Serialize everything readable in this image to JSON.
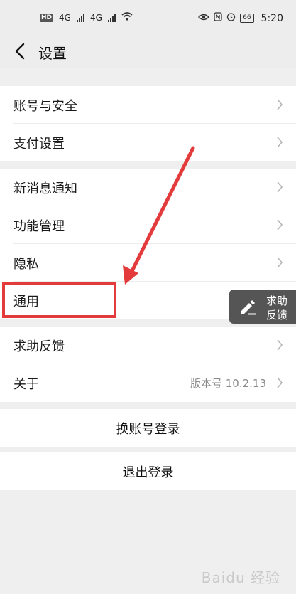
{
  "status_bar": {
    "hd_badge": "HD",
    "net1": "4G",
    "net2": "4G",
    "battery": "66",
    "time": "5:20"
  },
  "header": {
    "title": "设置"
  },
  "groups": [
    {
      "items": [
        {
          "label": "账号与安全"
        },
        {
          "label": "支付设置"
        }
      ]
    },
    {
      "items": [
        {
          "label": "新消息通知"
        },
        {
          "label": "功能管理"
        },
        {
          "label": "隐私"
        },
        {
          "label": "通用"
        }
      ]
    },
    {
      "items": [
        {
          "label": "求助反馈"
        },
        {
          "label": "关于",
          "value": "版本号 10.2.13"
        }
      ]
    }
  ],
  "actions": {
    "switch_account": "换账号登录",
    "logout": "退出登录"
  },
  "float_help": {
    "line1": "求助",
    "line2": "反馈"
  },
  "watermark": "Baidu 经验",
  "annotation": {
    "color": "#e33b3b"
  }
}
